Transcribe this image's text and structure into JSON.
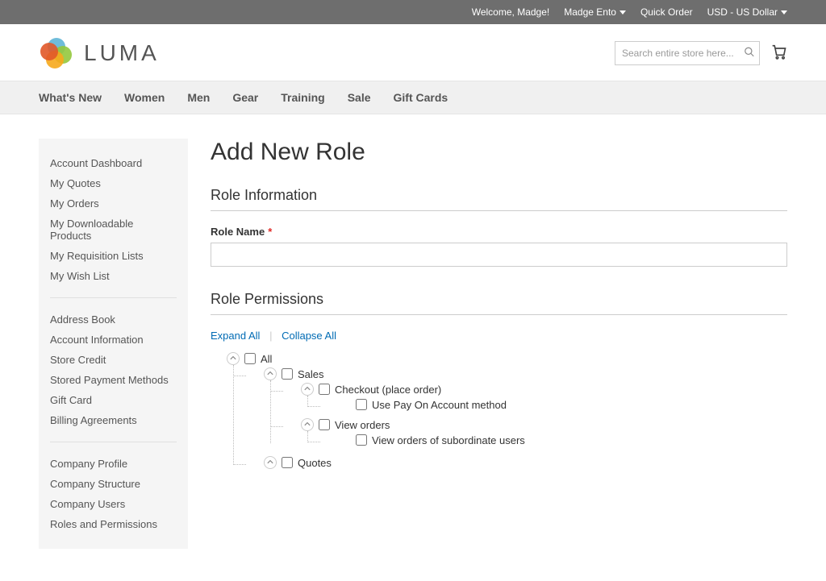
{
  "topbar": {
    "welcome": "Welcome, Madge!",
    "account": "Madge Ento",
    "quick_order": "Quick Order",
    "currency": "USD - US Dollar"
  },
  "header": {
    "logo_text": "LUMA"
  },
  "search": {
    "placeholder": "Search entire store here..."
  },
  "nav": [
    "What's New",
    "Women",
    "Men",
    "Gear",
    "Training",
    "Sale",
    "Gift Cards"
  ],
  "sidebar": {
    "groups": [
      [
        "Account Dashboard",
        "My Quotes",
        "My Orders",
        "My Downloadable Products",
        "My Requisition Lists",
        "My Wish List"
      ],
      [
        "Address Book",
        "Account Information",
        "Store Credit",
        "Stored Payment Methods",
        "Gift Card",
        "Billing Agreements"
      ],
      [
        "Company Profile",
        "Company Structure",
        "Company Users",
        "Roles and Permissions"
      ]
    ]
  },
  "page": {
    "title": "Add New Role",
    "role_info_title": "Role Information",
    "role_name_label": "Role Name",
    "role_name_value": "",
    "role_perm_title": "Role Permissions",
    "expand_all": "Expand All",
    "collapse_all": "Collapse All"
  },
  "tree": {
    "all": "All",
    "sales": "Sales",
    "checkout": "Checkout (place order)",
    "pay_on_account": "Use Pay On Account method",
    "view_orders": "View orders",
    "view_orders_sub": "View orders of subordinate users",
    "quotes": "Quotes"
  }
}
